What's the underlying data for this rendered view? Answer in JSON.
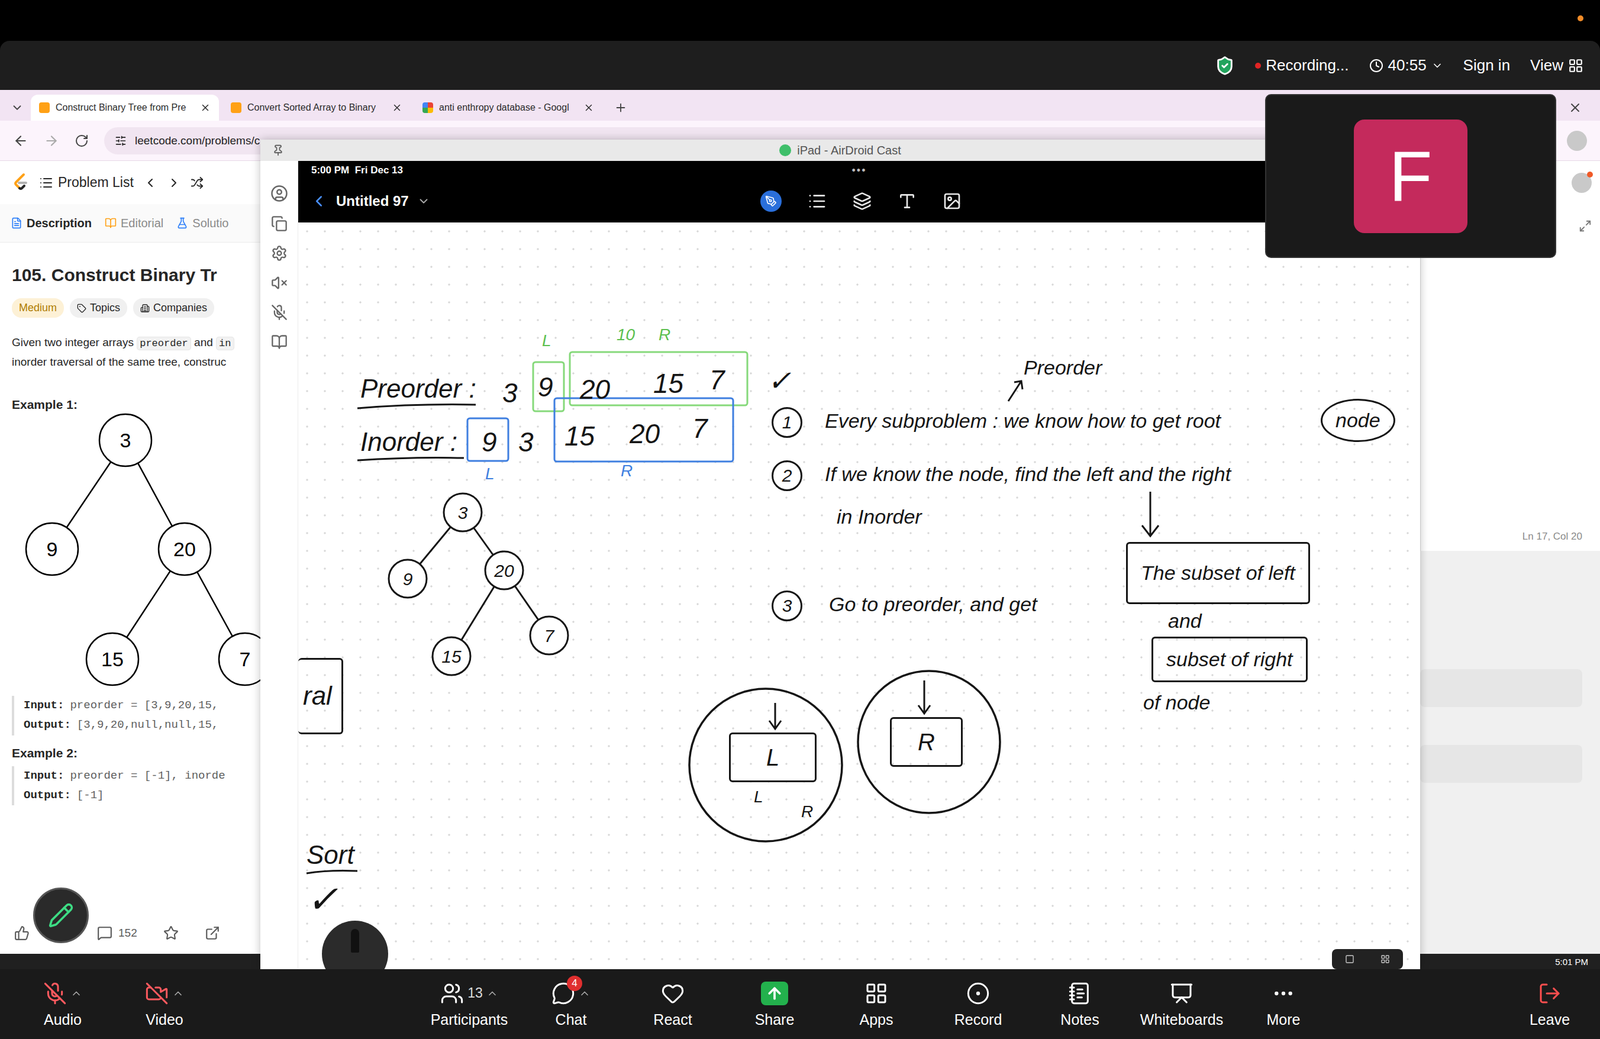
{
  "zoom_header": {
    "recording": "Recording...",
    "timer": "40:55",
    "sign_in": "Sign in",
    "view": "View"
  },
  "browser": {
    "tabs": [
      {
        "label": "Construct Binary Tree from Pre",
        "selected": true
      },
      {
        "label": "Convert Sorted Array to Binary",
        "selected": false
      },
      {
        "label": "anti enthropy database - Googl",
        "selected": false
      }
    ],
    "address": "leetcode.com/problems/c"
  },
  "leetcode": {
    "problem_list": "Problem List",
    "tabs": [
      {
        "label": "Description",
        "selected": true
      },
      {
        "label": "Editorial",
        "selected": false
      },
      {
        "label": "Solutio",
        "selected": false
      }
    ],
    "title": "105. Construct Binary Tr",
    "difficulty": "Medium",
    "tags": [
      "Topics",
      "Companies"
    ],
    "description": [
      [
        {
          "text": "Given two integer arrays ",
          "code": false
        },
        {
          "text": "preorder",
          "code": true
        },
        {
          "text": " and ",
          "code": false
        },
        {
          "text": "in",
          "code": true
        }
      ],
      [
        {
          "text": "inorder traversal of the same tree, construc",
          "code": false
        }
      ]
    ],
    "examples": [
      {
        "heading": "Example 1:",
        "tree": [
          "3",
          "9",
          "20",
          "15",
          "7"
        ],
        "lines": [
          {
            "key": "Input:",
            "value": "preorder = [3,9,20,15,"
          },
          {
            "key": "Output:",
            "value": "[3,9,20,null,null,15,"
          }
        ]
      },
      {
        "heading": "Example 2:",
        "tree": [],
        "lines": [
          {
            "key": "Input:",
            "value": "preorder = [-1], inorde"
          },
          {
            "key": "Output:",
            "value": "[-1]"
          }
        ]
      }
    ],
    "comments": "152",
    "editor_status": "Ln 17, Col 20"
  },
  "airdroid": {
    "title": "iPad - AirDroid Cast"
  },
  "ipad": {
    "time": "5:00 PM",
    "date": "Fri Dec 13",
    "menu": "•••",
    "doc_title": "Untitled 97"
  },
  "whiteboard": {
    "preorder": {
      "label": "Preorder :",
      "values": [
        "3",
        "9",
        "20",
        "15",
        "7"
      ],
      "marks": [
        "L",
        "10",
        "R"
      ]
    },
    "inorder": {
      "label": "Inorder :",
      "values": [
        "9",
        "3",
        "15",
        "20",
        "7"
      ],
      "marks": [
        "L",
        "R"
      ]
    },
    "check": "✓",
    "tree": [
      "3",
      "9",
      "20",
      "15",
      "7"
    ],
    "annotation": "Preorder",
    "steps": [
      {
        "number": "1",
        "text": "Every subproblem : we know how to get root",
        "circled": "node"
      },
      {
        "number": "2",
        "text": "If we know the node, find the left and the right",
        "continuation": "in Inorder"
      },
      {
        "number": "3",
        "text": "Go to preorder, and get",
        "boxes": [
          "The subset of left",
          "subset of right"
        ],
        "joiner": "and",
        "tail": "of node"
      }
    ],
    "subtrees": [
      {
        "label": "L",
        "marks": [
          "L",
          "R"
        ]
      },
      {
        "label": "R",
        "marks": []
      }
    ],
    "margin_box": "ral",
    "margin_note": "Sort",
    "margin_check": "✓"
  },
  "video_tile": {
    "initial": "F"
  },
  "toolbar": {
    "items": [
      {
        "label": "Audio",
        "kind": "audio",
        "muted": true,
        "caret": true,
        "count": "",
        "badge": ""
      },
      {
        "label": "Video",
        "kind": "video",
        "muted": true,
        "caret": true,
        "count": "",
        "badge": ""
      },
      {
        "label": "Participants",
        "kind": "participants",
        "muted": false,
        "caret": true,
        "count": "13",
        "badge": ""
      },
      {
        "label": "Chat",
        "kind": "chat",
        "muted": false,
        "caret": true,
        "count": "",
        "badge": "4"
      },
      {
        "label": "React",
        "kind": "react",
        "muted": false,
        "caret": false,
        "count": "",
        "badge": ""
      },
      {
        "label": "Share",
        "kind": "share",
        "muted": false,
        "caret": false,
        "count": "",
        "badge": ""
      },
      {
        "label": "Apps",
        "kind": "apps",
        "muted": false,
        "caret": false,
        "count": "",
        "badge": ""
      },
      {
        "label": "Record",
        "kind": "record",
        "muted": false,
        "caret": false,
        "count": "",
        "badge": ""
      },
      {
        "label": "Notes",
        "kind": "notes",
        "muted": false,
        "caret": false,
        "count": "",
        "badge": ""
      },
      {
        "label": "Whiteboards",
        "kind": "whiteboards",
        "muted": false,
        "caret": false,
        "count": "",
        "badge": ""
      },
      {
        "label": "More",
        "kind": "more",
        "muted": false,
        "caret": false,
        "count": "",
        "badge": ""
      },
      {
        "label": "Leave",
        "kind": "leave",
        "muted": false,
        "caret": false,
        "count": "",
        "badge": ""
      }
    ]
  },
  "taskbar": {
    "time": "5:01 PM"
  }
}
